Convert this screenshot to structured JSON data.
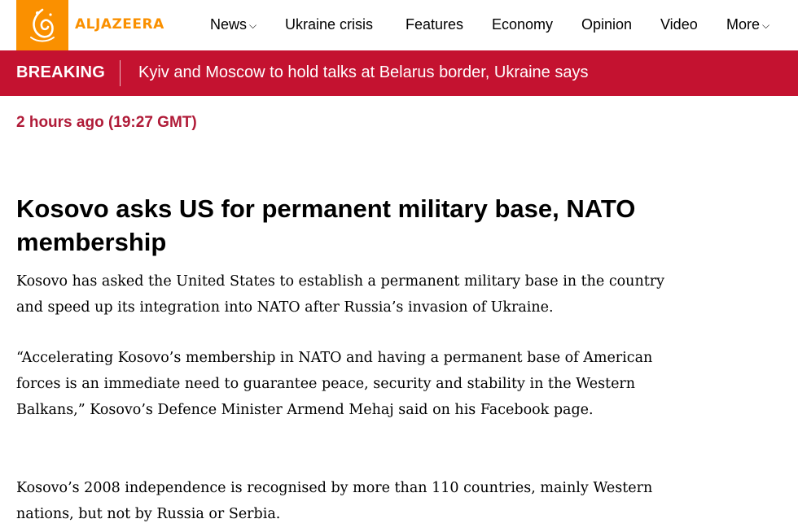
{
  "brand": {
    "logo_text": "ALJAZEERA",
    "accent": "#fa9000",
    "breaking_color": "#c41230"
  },
  "nav": {
    "items": [
      {
        "label": "News",
        "has_dropdown": true
      },
      {
        "label": "Ukraine crisis",
        "has_dropdown": false
      },
      {
        "label": "Features",
        "has_dropdown": false
      },
      {
        "label": "Economy",
        "has_dropdown": false
      },
      {
        "label": "Opinion",
        "has_dropdown": false
      },
      {
        "label": "Video",
        "has_dropdown": false
      },
      {
        "label": "More",
        "has_dropdown": true
      }
    ],
    "dropdown_icon": "chevron-down-icon"
  },
  "breaking": {
    "label": "BREAKING",
    "headline": "Kyiv and Moscow to hold talks at Belarus border, Ukraine says"
  },
  "article": {
    "timestamp": "2 hours ago (19:27 GMT)",
    "title": "Kosovo asks US for permanent military base, NATO membership",
    "paragraphs": [
      "Kosovo has asked the United States to establish a permanent military base in the coun­try and speed up its integration into NATO after Russia’s invasion of Ukraine.",
      "“Accelerating Kosovo’s membership in NATO and having a permanent base of American forces is an immediate need to guarantee peace, security and stability in the Western Balkans,” Kosovo’s Defence Minister Armend Mehaj said on his Facebook page.",
      "Kosovo’s 2008 independence is recognised by more than 110 countries, mainly Western nations, but not by Russia or Serbia."
    ]
  }
}
